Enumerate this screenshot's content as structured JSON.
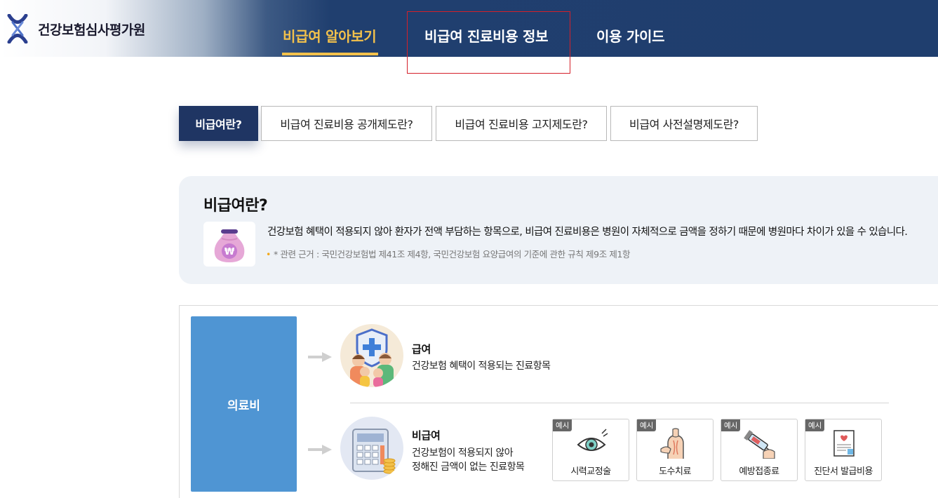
{
  "header": {
    "logo_text": "건강보험심사평가원",
    "nav": [
      {
        "label": "비급여 알아보기",
        "active": true
      },
      {
        "label": "비급여 진료비용 정보",
        "active": false
      },
      {
        "label": "이용 가이드",
        "active": false
      }
    ]
  },
  "tabs": [
    {
      "label": "비급여란?",
      "active": true
    },
    {
      "label": "비급여 진료비용 공개제도란?",
      "active": false
    },
    {
      "label": "비급여 진료비용 고지제도란?",
      "active": false
    },
    {
      "label": "비급여 사전설명제도란?",
      "active": false
    }
  ],
  "info": {
    "title": "비급여란?",
    "icon": "money-bag-icon",
    "description": "건강보험 혜택이 적용되지 않아 환자가 전액 부담하는 항목으로, 비급여 진료비용은 병원이 자체적으로 금액을 정하기 때문에 병원마다 차이가 있을 수 있습니다.",
    "note": "* 관련 근거 : 국민건강보험법 제41조 제4항, 국민건강보험 요양급여의 기준에 관한 규칙 제9조 제1항"
  },
  "diagram": {
    "root_label": "의료비",
    "covered": {
      "title": "급여",
      "description": "건강보험 혜택이 적용되는 진료항목",
      "icon": "family-shield-icon"
    },
    "non_covered": {
      "title": "비급여",
      "description_line1": "건강보험이 적용되지 않아",
      "description_line2": "정해진 금액이 없는 진료항목",
      "icon": "calculator-icon"
    },
    "example_badge": "예시",
    "examples": [
      {
        "label": "시력교정술",
        "icon": "eye-icon"
      },
      {
        "label": "도수치료",
        "icon": "manual-therapy-icon"
      },
      {
        "label": "예방접종료",
        "icon": "syringe-icon"
      },
      {
        "label": "진단서 발급비용",
        "icon": "certificate-icon"
      }
    ]
  },
  "colors": {
    "header_navy": "#1f3e6e",
    "nav_active": "#f3c14b",
    "tab_active": "#1f3563",
    "medical_box": "#4f95d3",
    "focus_outline": "#d4202a"
  }
}
